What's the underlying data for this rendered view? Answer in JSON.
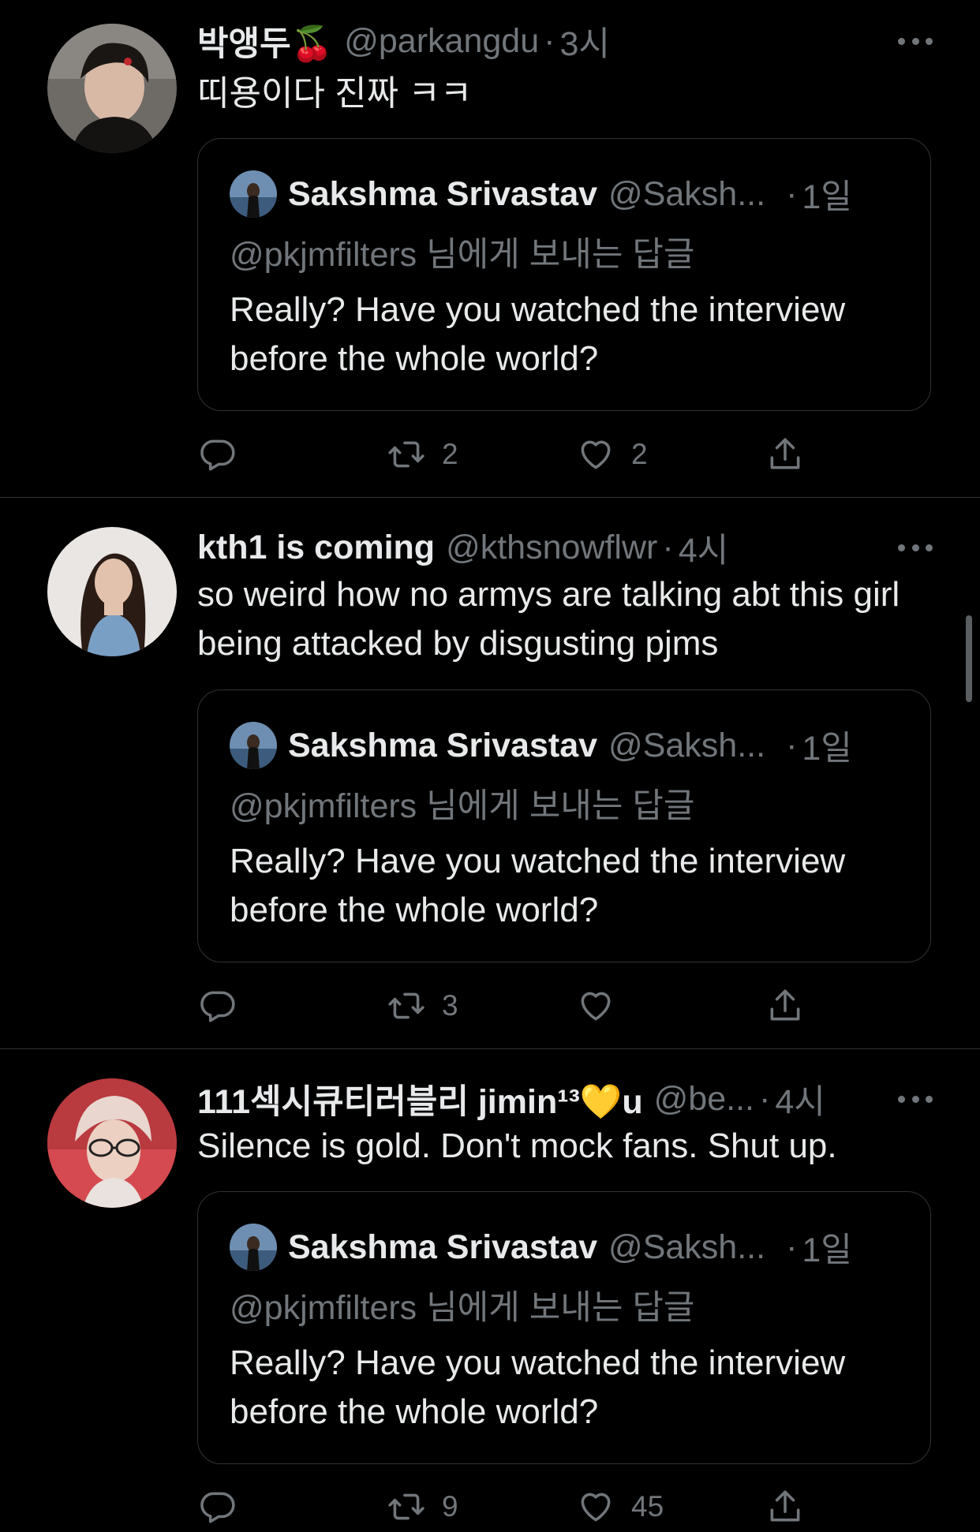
{
  "tweets": [
    {
      "name": "박앵두🍒",
      "handle": "@parkangdu",
      "sep": "·",
      "time": "3시",
      "text": "띠용이다 진짜 ㅋㅋ",
      "quote": {
        "name": "Sakshma Srivastav",
        "handle": "@Saksh...",
        "sep": "·",
        "time": "1일",
        "reply_to": "@pkjmfilters 님에게 보내는 답글",
        "text": "Really? Have you watched the interview before the whole world?"
      },
      "retweets": "2",
      "likes": "2"
    },
    {
      "name": "kth1 is coming",
      "handle": "@kthsnowflwr",
      "sep": "·",
      "time": "4시",
      "text": "so weird how no armys are talking abt this girl being attacked by disgusting pjms",
      "quote": {
        "name": "Sakshma Srivastav",
        "handle": "@Saksh...",
        "sep": "·",
        "time": "1일",
        "reply_to": "@pkjmfilters 님에게 보내는 답글",
        "text": "Really? Have you watched the interview before the whole world?"
      },
      "retweets": "3",
      "likes": ""
    },
    {
      "name": "111섹시큐티러블리 jimin¹³💛u",
      "handle": "@be...",
      "sep": "·",
      "time": "4시",
      "text": "Silence is gold. Don't mock fans. Shut up.",
      "quote": {
        "name": "Sakshma Srivastav",
        "handle": "@Saksh...",
        "sep": "·",
        "time": "1일",
        "reply_to": "@pkjmfilters 님에게 보내는 답글",
        "text": "Really? Have you watched the interview before the whole world?"
      },
      "retweets": "9",
      "likes": "45"
    }
  ],
  "icons": {
    "reply": "reply-icon",
    "retweet": "retweet-icon",
    "like": "heart-icon",
    "share": "share-icon",
    "more": "more-icon"
  },
  "colors": {
    "background": "#000000",
    "text": "#e7e9ea",
    "secondary": "#71767b",
    "border": "#2f3336"
  }
}
